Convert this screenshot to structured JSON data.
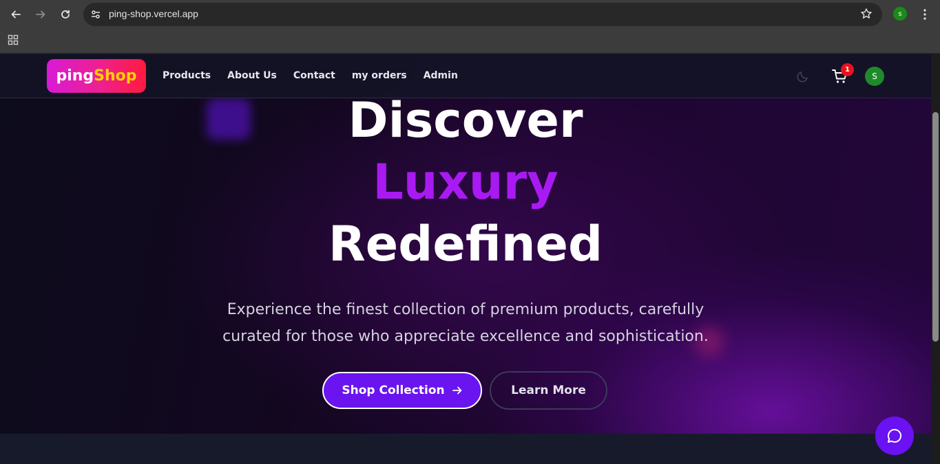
{
  "browser": {
    "url": "ping-shop.vercel.app",
    "profile_initial": "s",
    "icons": {
      "back": "back-arrow-icon",
      "forward": "forward-arrow-icon",
      "reload": "reload-icon",
      "site_info": "site-info-icon",
      "bookmark": "star-icon",
      "menu": "kebab-menu-icon",
      "apps": "apps-grid-icon"
    }
  },
  "navbar": {
    "logo_part1": "ping",
    "logo_part2": "Shop",
    "links": [
      "Products",
      "About Us",
      "Contact",
      "my orders",
      "Admin"
    ],
    "cart_count": "1",
    "avatar_initial": "S"
  },
  "hero": {
    "title_line1": "Discover",
    "title_line2": "Luxury",
    "title_line3": "Redefined",
    "subtitle_line1": "Experience the finest collection of premium products, carefully",
    "subtitle_line2": "curated for those who appreciate excellence and sophistication.",
    "primary_button": "Shop Collection",
    "secondary_button": "Learn More"
  },
  "colors": {
    "accent_purple": "#a91af2",
    "button_purple": "#6a14f0",
    "logo_gradient_start": "#d81bd6",
    "logo_gradient_end": "#ff1a3c",
    "logo_highlight": "#ffd200",
    "badge_red": "#e8121e",
    "avatar_green": "#1e8a2a"
  }
}
